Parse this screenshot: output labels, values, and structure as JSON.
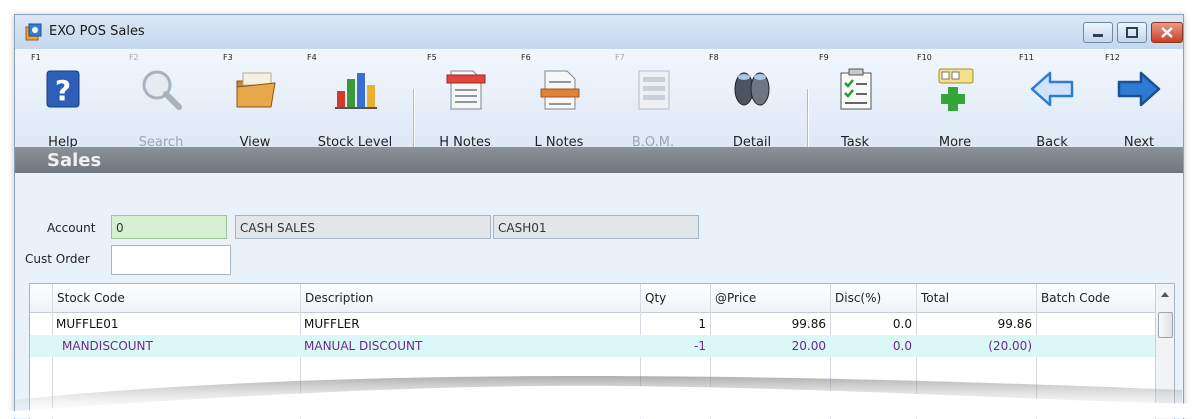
{
  "window": {
    "title": "EXO POS Sales"
  },
  "toolbar": [
    {
      "key": "F1",
      "label": "Help",
      "icon": "help-icon",
      "enabled": true
    },
    {
      "key": "F2",
      "label": "Search",
      "icon": "search-icon",
      "enabled": false
    },
    {
      "key": "F3",
      "label": "View",
      "icon": "folder-icon",
      "enabled": true
    },
    {
      "key": "F4",
      "label": "Stock Level",
      "icon": "bar-chart-icon",
      "enabled": true
    },
    {
      "key": "F5",
      "label": "H Notes",
      "icon": "header-notes-icon",
      "enabled": true
    },
    {
      "key": "F6",
      "label": "L Notes",
      "icon": "line-notes-icon",
      "enabled": true
    },
    {
      "key": "F7",
      "label": "B.O.M.",
      "icon": "bom-icon",
      "enabled": false
    },
    {
      "key": "F8",
      "label": "Detail",
      "icon": "binoculars-icon",
      "enabled": true
    },
    {
      "key": "F9",
      "label": "Task",
      "icon": "task-icon",
      "enabled": true
    },
    {
      "key": "F10",
      "label": "More",
      "icon": "more-icon",
      "enabled": true
    },
    {
      "key": "F11",
      "label": "Back",
      "icon": "back-arrow-icon",
      "enabled": true
    },
    {
      "key": "F12",
      "label": "Next",
      "icon": "next-arrow-icon",
      "enabled": true
    }
  ],
  "section": {
    "title": "Sales"
  },
  "form": {
    "account_label": "Account",
    "account_value": "0",
    "account_name": "CASH SALES",
    "account_code": "CASH01",
    "cust_order_label": "Cust Order",
    "cust_order_value": ""
  },
  "grid": {
    "columns": [
      "Stock Code",
      "Description",
      "Qty",
      "@Price",
      "Disc(%)",
      "Total",
      "Batch Code"
    ],
    "rows": [
      {
        "stock_code": "MUFFLE01",
        "description": "MUFFLER",
        "qty": "1",
        "price": "99.86",
        "disc": "0.0",
        "total": "99.86",
        "batch": ""
      },
      {
        "stock_code": "MANDISCOUNT",
        "description": "MANUAL DISCOUNT",
        "qty": "-1",
        "price": "20.00",
        "disc": "0.0",
        "total": "(20.00)",
        "batch": ""
      }
    ]
  },
  "colors": {
    "accent": "#1f6fc7",
    "selected_row": "#dcf7f7",
    "discount_text": "#6b2a86",
    "account_field": "#d7f0d3"
  }
}
